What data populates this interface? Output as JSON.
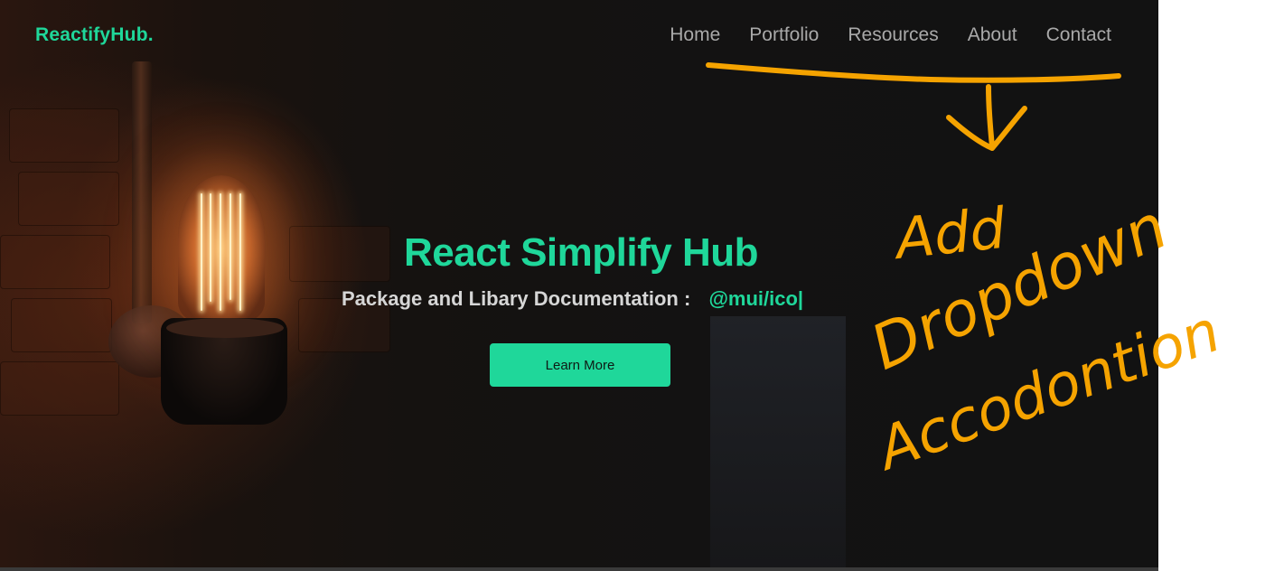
{
  "brand": {
    "name": "ReactifyHub."
  },
  "nav": {
    "items": [
      {
        "label": "Home"
      },
      {
        "label": "Portfolio"
      },
      {
        "label": "Resources"
      },
      {
        "label": "About"
      },
      {
        "label": "Contact"
      }
    ]
  },
  "hero": {
    "title": "React Simplify Hub",
    "subtitle_label": "Package and Libary Documentation :",
    "subtitle_typed": "@mui/ico|",
    "cta_label": "Learn More"
  },
  "colors": {
    "accent": "#1fd79a",
    "nav_text": "#a9a9a9",
    "annotation": "#f5a300"
  },
  "annotation": {
    "text_lines": [
      "Add",
      "Dropdown",
      "Accodontion"
    ]
  }
}
